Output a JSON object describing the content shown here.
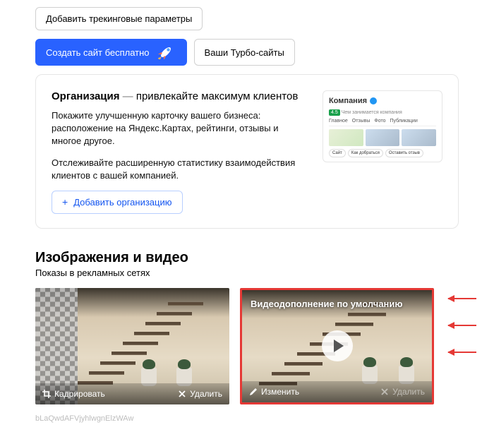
{
  "top": {
    "trackingParamsBtn": "Добавить трекинговые параметры",
    "createSiteBtn": "Создать сайт бесплатно",
    "turboSitesBtn": "Ваши Турбо-сайты"
  },
  "organization": {
    "title": "Организация",
    "dash": "—",
    "tagline": "привлекайте максимум клиентов",
    "desc1": "Покажите улучшенную карточку вашего бизнеса: расположение на Яндекс.Картах, рейтинги, отзывы и многое другое.",
    "desc2": "Отслеживайте расширенную статистику взаимодействия клиентов с вашей компанией.",
    "addBtn": "Добавить организацию",
    "preview": {
      "companyLabel": "Компания",
      "ratingSub": "Чем занимается компания",
      "tabs": [
        "Главное",
        "Отзывы",
        "Фото",
        "Публикации"
      ],
      "btns": [
        "Сайт",
        "Как добраться",
        "Оставить отзыв"
      ]
    }
  },
  "media": {
    "sectionTitle": "Изображения и видео",
    "sectionSub": "Показы в рекламных сетях",
    "cropBtn": "Кадрировать",
    "deleteBtn": "Удалить",
    "videoCaption": "Видеодополнение по умолчанию",
    "editBtn": "Изменить",
    "deleteBtn2": "Удалить",
    "hashNote": "bLaQwdAFVjyhlwgnElzWAw"
  }
}
